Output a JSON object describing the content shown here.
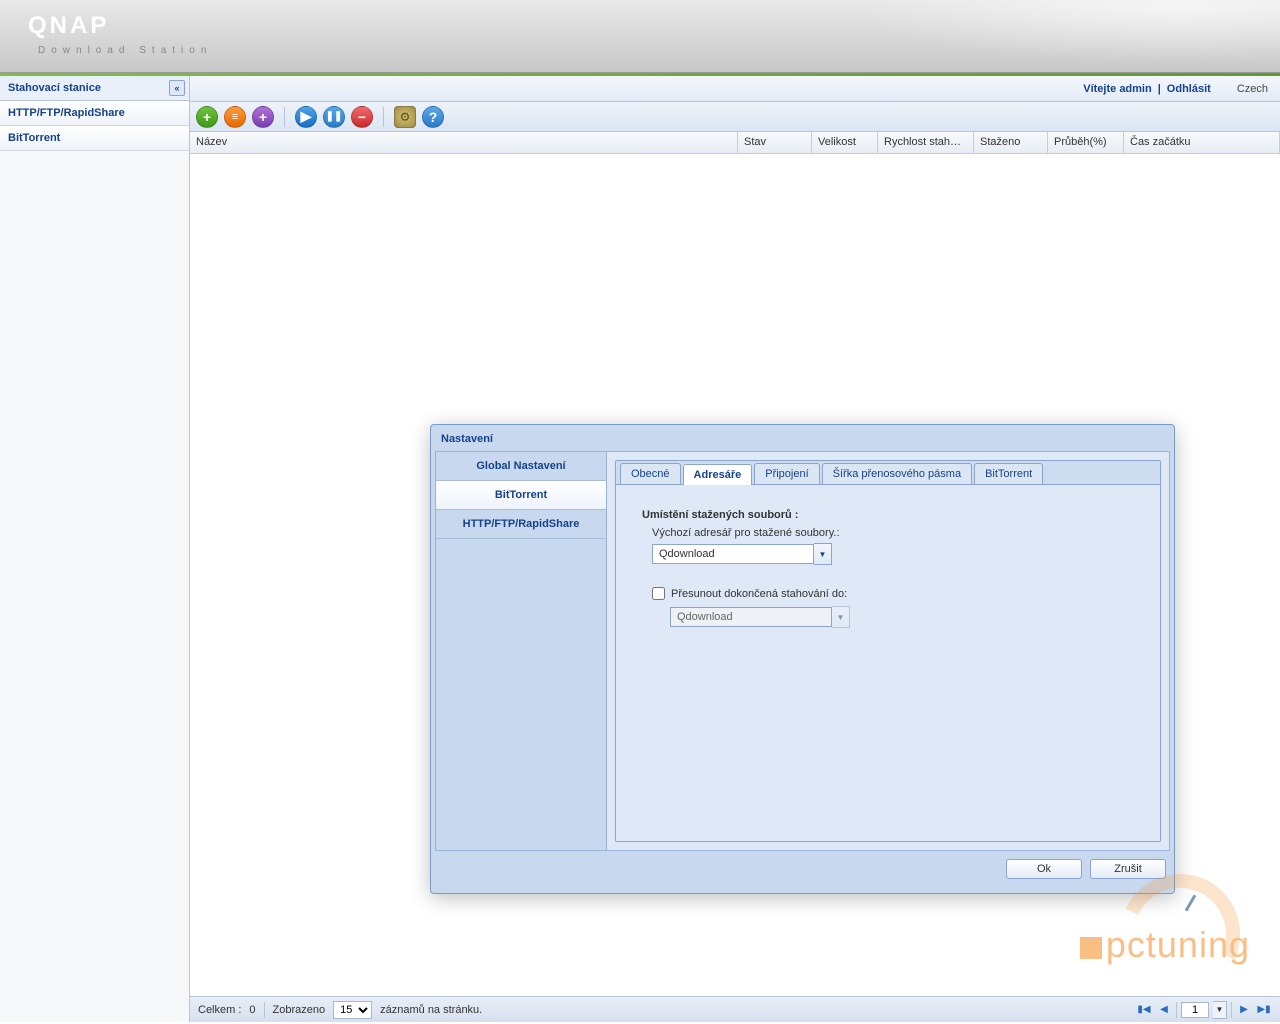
{
  "brand": {
    "name": "QNAP",
    "sub": "Download Station"
  },
  "sidebar": {
    "title": "Stahovací stanice",
    "items": [
      "HTTP/FTP/RapidShare",
      "BitTorrent"
    ]
  },
  "topbar": {
    "welcome": "Vítejte admin",
    "logout": "Odhlásit",
    "lang": "Czech"
  },
  "columns": [
    "Název",
    "Stav",
    "Velikost",
    "Rychlost stahov…",
    "Staženo",
    "Průběh(%)",
    "Čas začátku"
  ],
  "status": {
    "total_label": "Celkem :",
    "total": "0",
    "shown_label": "Zobrazeno",
    "per": "15",
    "suffix": "záznamů na stránku.",
    "page": "1"
  },
  "dialog": {
    "title": "Nastavení",
    "nav": [
      "Global Nastavení",
      "BitTorrent",
      "HTTP/FTP/RapidShare"
    ],
    "tabs": [
      "Obecné",
      "Adresáře",
      "Připojení",
      "Šířka přenosového pásma",
      "BitTorrent"
    ],
    "activeTab": 1,
    "section_title": "Umístění stažených souborů :",
    "default_label": "Výchozí adresář pro stažené soubory.:",
    "default_value": "Qdownload",
    "move_label": "Přesunout dokončená stahování do:",
    "move_value": "Qdownload",
    "ok": "Ok",
    "cancel": "Zrušit"
  },
  "watermark": "pctuning"
}
